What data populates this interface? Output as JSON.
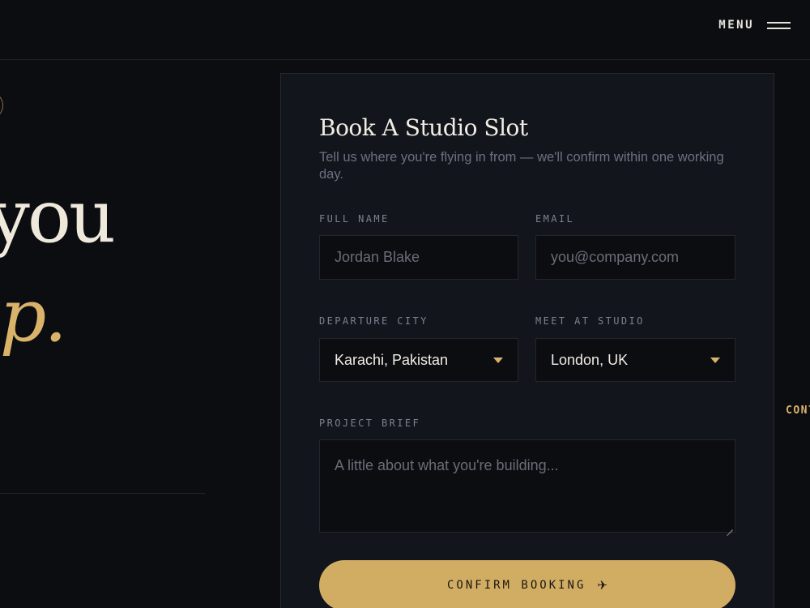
{
  "header": {
    "menu_label": "MENU",
    "menu_icon": "hamburger-icon"
  },
  "hero": {
    "line1": "you",
    "line2": "up."
  },
  "edge": {
    "link_text": "CONT"
  },
  "booking": {
    "title": "Book A Studio Slot",
    "subtitle": "Tell us where you're flying in from — we'll confirm within one working day.",
    "full_name": {
      "label": "FULL NAME",
      "placeholder": "Jordan Blake",
      "value": ""
    },
    "email": {
      "label": "EMAIL",
      "placeholder": "you@company.com",
      "value": ""
    },
    "departure_city": {
      "label": "DEPARTURE CITY",
      "selected": "Karachi, Pakistan"
    },
    "meet_at_studio": {
      "label": "MEET AT STUDIO",
      "selected": "London, UK"
    },
    "project_brief": {
      "label": "PROJECT BRIEF",
      "placeholder": "A little about what you're building..."
    },
    "confirm_label": "CONFIRM BOOKING",
    "confirm_icon": "plane-icon",
    "plane_glyph": "✈"
  },
  "colors": {
    "background": "#0c0d11",
    "card": "#13151c",
    "accent": "#d1ad64",
    "text": "#f1ede4",
    "muted": "#6d7080"
  }
}
